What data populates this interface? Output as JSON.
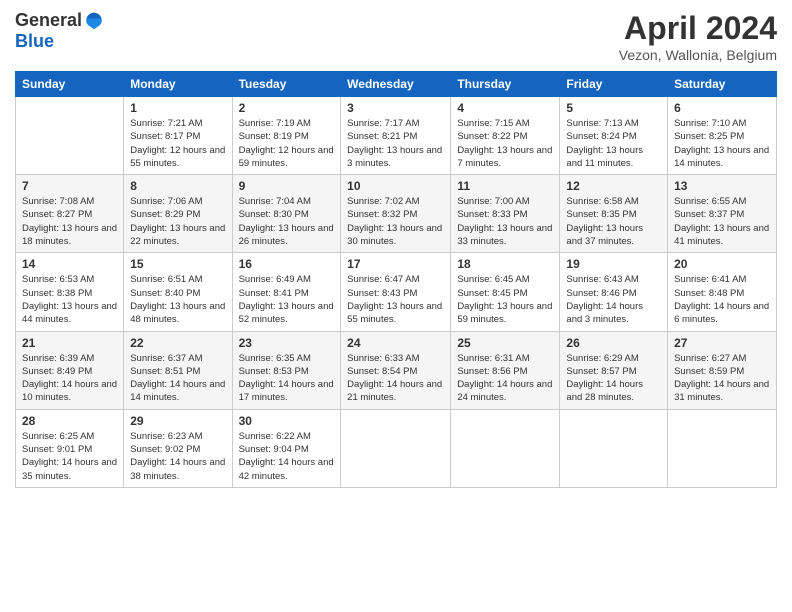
{
  "logo": {
    "general": "General",
    "blue": "Blue"
  },
  "title": "April 2024",
  "location": "Vezon, Wallonia, Belgium",
  "days_header": [
    "Sunday",
    "Monday",
    "Tuesday",
    "Wednesday",
    "Thursday",
    "Friday",
    "Saturday"
  ],
  "weeks": [
    [
      {
        "day": "",
        "sunrise": "",
        "sunset": "",
        "daylight": ""
      },
      {
        "day": "1",
        "sunrise": "Sunrise: 7:21 AM",
        "sunset": "Sunset: 8:17 PM",
        "daylight": "Daylight: 12 hours and 55 minutes."
      },
      {
        "day": "2",
        "sunrise": "Sunrise: 7:19 AM",
        "sunset": "Sunset: 8:19 PM",
        "daylight": "Daylight: 12 hours and 59 minutes."
      },
      {
        "day": "3",
        "sunrise": "Sunrise: 7:17 AM",
        "sunset": "Sunset: 8:21 PM",
        "daylight": "Daylight: 13 hours and 3 minutes."
      },
      {
        "day": "4",
        "sunrise": "Sunrise: 7:15 AM",
        "sunset": "Sunset: 8:22 PM",
        "daylight": "Daylight: 13 hours and 7 minutes."
      },
      {
        "day": "5",
        "sunrise": "Sunrise: 7:13 AM",
        "sunset": "Sunset: 8:24 PM",
        "daylight": "Daylight: 13 hours and 11 minutes."
      },
      {
        "day": "6",
        "sunrise": "Sunrise: 7:10 AM",
        "sunset": "Sunset: 8:25 PM",
        "daylight": "Daylight: 13 hours and 14 minutes."
      }
    ],
    [
      {
        "day": "7",
        "sunrise": "Sunrise: 7:08 AM",
        "sunset": "Sunset: 8:27 PM",
        "daylight": "Daylight: 13 hours and 18 minutes."
      },
      {
        "day": "8",
        "sunrise": "Sunrise: 7:06 AM",
        "sunset": "Sunset: 8:29 PM",
        "daylight": "Daylight: 13 hours and 22 minutes."
      },
      {
        "day": "9",
        "sunrise": "Sunrise: 7:04 AM",
        "sunset": "Sunset: 8:30 PM",
        "daylight": "Daylight: 13 hours and 26 minutes."
      },
      {
        "day": "10",
        "sunrise": "Sunrise: 7:02 AM",
        "sunset": "Sunset: 8:32 PM",
        "daylight": "Daylight: 13 hours and 30 minutes."
      },
      {
        "day": "11",
        "sunrise": "Sunrise: 7:00 AM",
        "sunset": "Sunset: 8:33 PM",
        "daylight": "Daylight: 13 hours and 33 minutes."
      },
      {
        "day": "12",
        "sunrise": "Sunrise: 6:58 AM",
        "sunset": "Sunset: 8:35 PM",
        "daylight": "Daylight: 13 hours and 37 minutes."
      },
      {
        "day": "13",
        "sunrise": "Sunrise: 6:55 AM",
        "sunset": "Sunset: 8:37 PM",
        "daylight": "Daylight: 13 hours and 41 minutes."
      }
    ],
    [
      {
        "day": "14",
        "sunrise": "Sunrise: 6:53 AM",
        "sunset": "Sunset: 8:38 PM",
        "daylight": "Daylight: 13 hours and 44 minutes."
      },
      {
        "day": "15",
        "sunrise": "Sunrise: 6:51 AM",
        "sunset": "Sunset: 8:40 PM",
        "daylight": "Daylight: 13 hours and 48 minutes."
      },
      {
        "day": "16",
        "sunrise": "Sunrise: 6:49 AM",
        "sunset": "Sunset: 8:41 PM",
        "daylight": "Daylight: 13 hours and 52 minutes."
      },
      {
        "day": "17",
        "sunrise": "Sunrise: 6:47 AM",
        "sunset": "Sunset: 8:43 PM",
        "daylight": "Daylight: 13 hours and 55 minutes."
      },
      {
        "day": "18",
        "sunrise": "Sunrise: 6:45 AM",
        "sunset": "Sunset: 8:45 PM",
        "daylight": "Daylight: 13 hours and 59 minutes."
      },
      {
        "day": "19",
        "sunrise": "Sunrise: 6:43 AM",
        "sunset": "Sunset: 8:46 PM",
        "daylight": "Daylight: 14 hours and 3 minutes."
      },
      {
        "day": "20",
        "sunrise": "Sunrise: 6:41 AM",
        "sunset": "Sunset: 8:48 PM",
        "daylight": "Daylight: 14 hours and 6 minutes."
      }
    ],
    [
      {
        "day": "21",
        "sunrise": "Sunrise: 6:39 AM",
        "sunset": "Sunset: 8:49 PM",
        "daylight": "Daylight: 14 hours and 10 minutes."
      },
      {
        "day": "22",
        "sunrise": "Sunrise: 6:37 AM",
        "sunset": "Sunset: 8:51 PM",
        "daylight": "Daylight: 14 hours and 14 minutes."
      },
      {
        "day": "23",
        "sunrise": "Sunrise: 6:35 AM",
        "sunset": "Sunset: 8:53 PM",
        "daylight": "Daylight: 14 hours and 17 minutes."
      },
      {
        "day": "24",
        "sunrise": "Sunrise: 6:33 AM",
        "sunset": "Sunset: 8:54 PM",
        "daylight": "Daylight: 14 hours and 21 minutes."
      },
      {
        "day": "25",
        "sunrise": "Sunrise: 6:31 AM",
        "sunset": "Sunset: 8:56 PM",
        "daylight": "Daylight: 14 hours and 24 minutes."
      },
      {
        "day": "26",
        "sunrise": "Sunrise: 6:29 AM",
        "sunset": "Sunset: 8:57 PM",
        "daylight": "Daylight: 14 hours and 28 minutes."
      },
      {
        "day": "27",
        "sunrise": "Sunrise: 6:27 AM",
        "sunset": "Sunset: 8:59 PM",
        "daylight": "Daylight: 14 hours and 31 minutes."
      }
    ],
    [
      {
        "day": "28",
        "sunrise": "Sunrise: 6:25 AM",
        "sunset": "Sunset: 9:01 PM",
        "daylight": "Daylight: 14 hours and 35 minutes."
      },
      {
        "day": "29",
        "sunrise": "Sunrise: 6:23 AM",
        "sunset": "Sunset: 9:02 PM",
        "daylight": "Daylight: 14 hours and 38 minutes."
      },
      {
        "day": "30",
        "sunrise": "Sunrise: 6:22 AM",
        "sunset": "Sunset: 9:04 PM",
        "daylight": "Daylight: 14 hours and 42 minutes."
      },
      {
        "day": "",
        "sunrise": "",
        "sunset": "",
        "daylight": ""
      },
      {
        "day": "",
        "sunrise": "",
        "sunset": "",
        "daylight": ""
      },
      {
        "day": "",
        "sunrise": "",
        "sunset": "",
        "daylight": ""
      },
      {
        "day": "",
        "sunrise": "",
        "sunset": "",
        "daylight": ""
      }
    ]
  ]
}
